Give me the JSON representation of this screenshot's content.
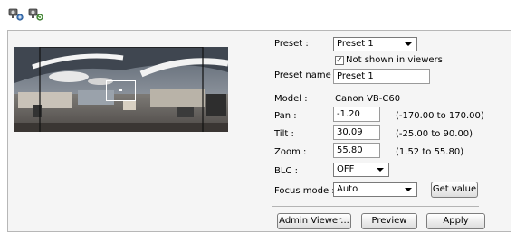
{
  "toolbar": {
    "buttons": [
      {
        "icon": "camera-settings-icon"
      },
      {
        "icon": "camera-refresh-icon"
      }
    ]
  },
  "preview": {
    "icon": "panorama-preview-image"
  },
  "form": {
    "preset_label": "Preset :",
    "preset_value": "Preset 1",
    "not_shown_checked": true,
    "not_shown_label": "Not shown in viewers",
    "preset_name_label": "Preset name :",
    "preset_name_value": "Preset 1",
    "model_label": "Model :",
    "model_value": "Canon VB-C60",
    "pan_label": "Pan :",
    "pan_value": "-1.20",
    "pan_range": "(-170.00 to 170.00)",
    "tilt_label": "Tilt :",
    "tilt_value": "30.09",
    "tilt_range": "(-25.00 to 90.00)",
    "zoom_label": "Zoom :",
    "zoom_value": "55.80",
    "zoom_range": "(1.52 to 55.80)",
    "blc_label": "BLC :",
    "blc_value": "OFF",
    "focus_label": "Focus mode :",
    "focus_value": "Auto",
    "get_value_label": "Get value"
  },
  "footer": {
    "admin_viewer_label": "Admin Viewer...",
    "preview_label": "Preview",
    "apply_label": "Apply"
  },
  "colors": {
    "panel_bg": "#f5f5f5",
    "panel_border": "#b7b7b7"
  }
}
